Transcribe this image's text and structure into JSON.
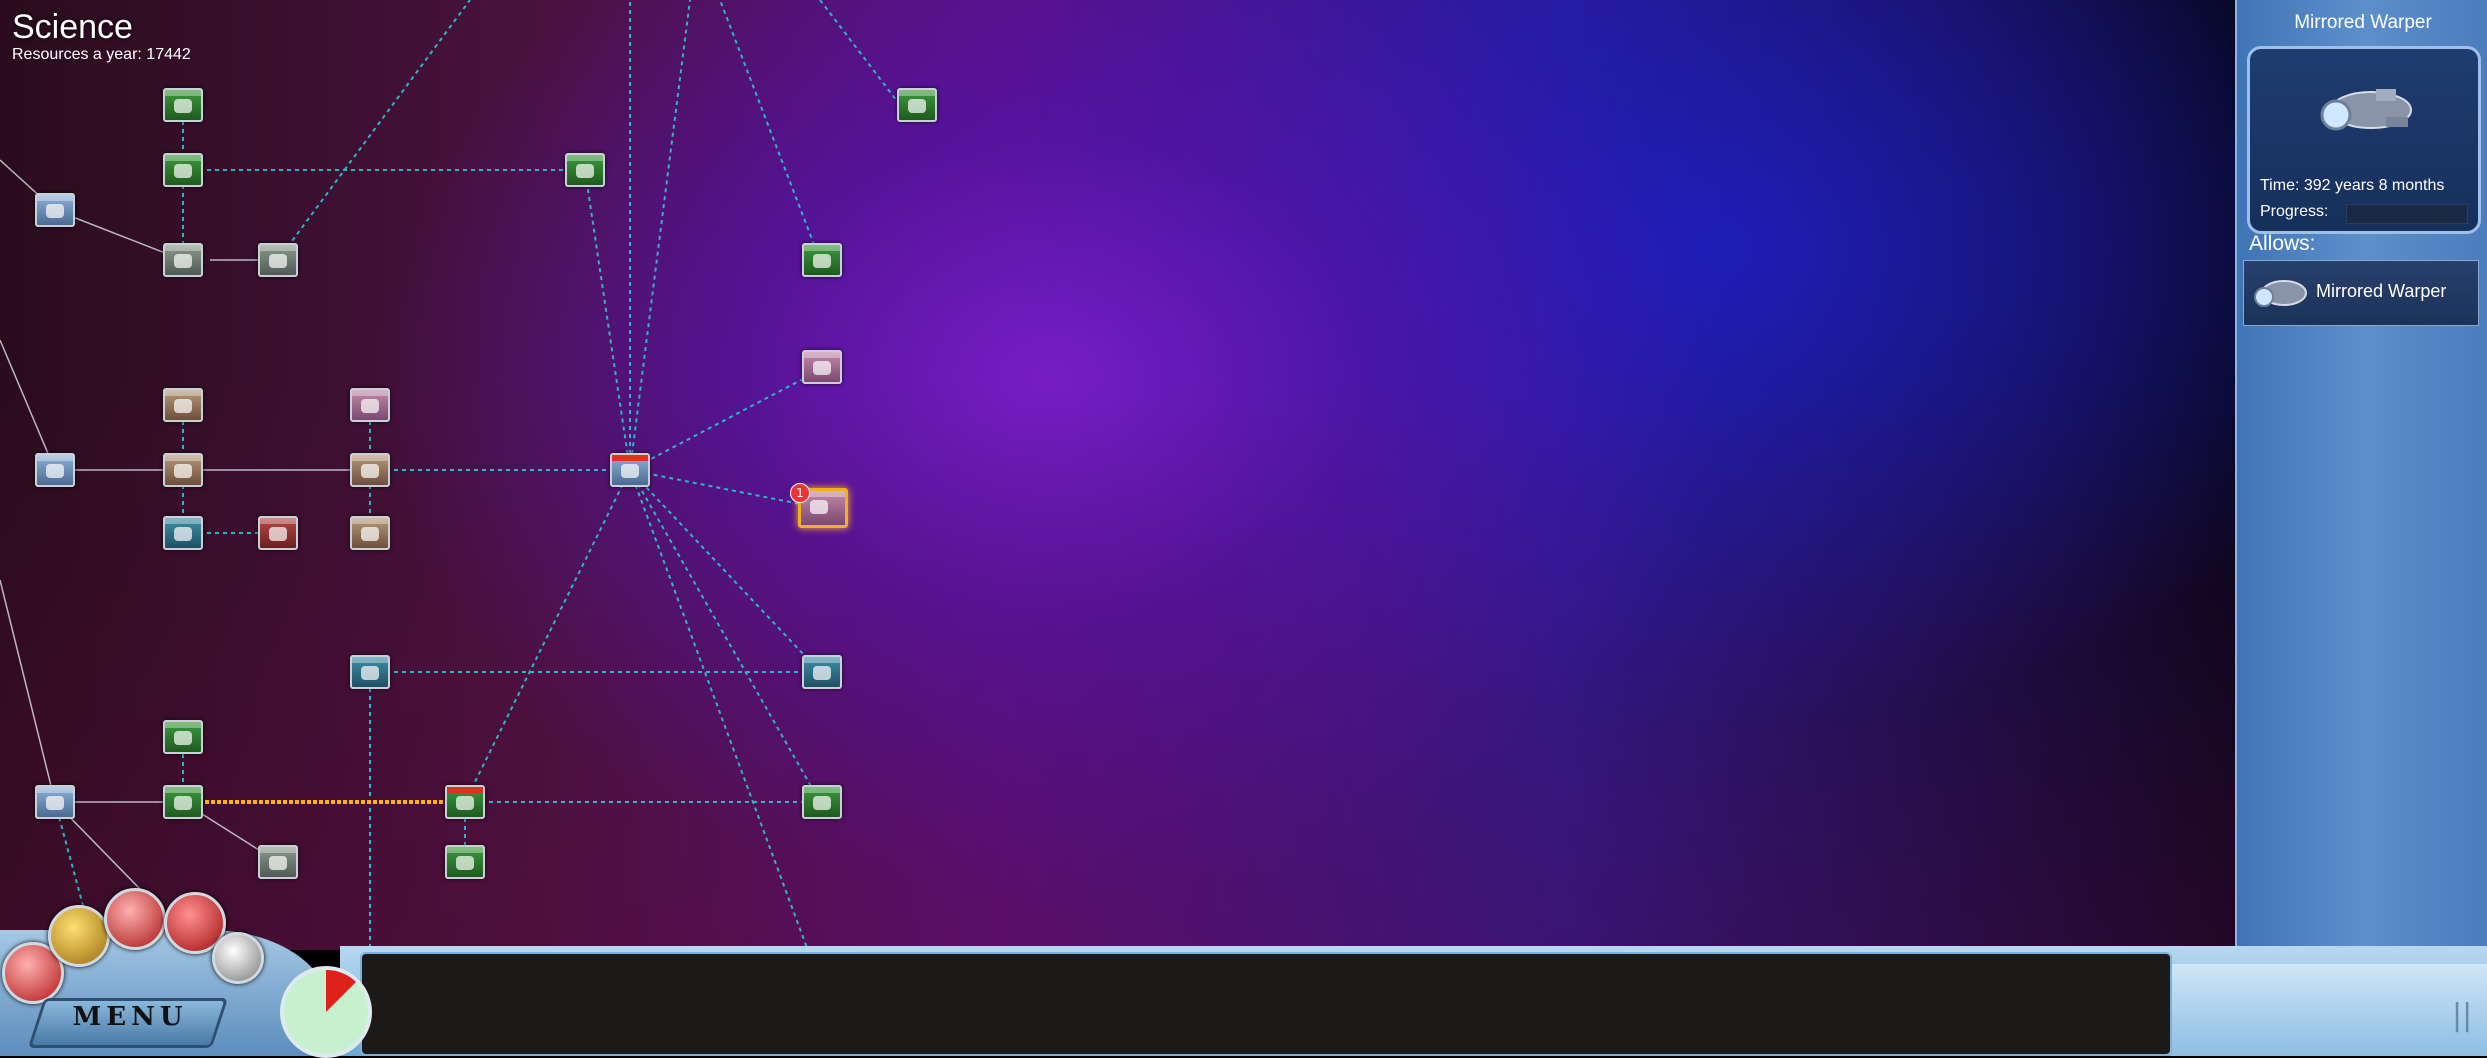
{
  "screen": {
    "title": "Science",
    "resources_label": "Resources a year:",
    "resources_value": "17442"
  },
  "tree": {
    "selected_badge": "1"
  },
  "panel": {
    "selected_name": "Mirrored Warper",
    "time_label": "Time:",
    "time_value": "392 years 8 months",
    "progress_label": "Progress:",
    "progress_fraction": 0,
    "allows_label": "Allows:",
    "allows": [
      {
        "name": "Mirrored Warper"
      }
    ]
  },
  "bottom": {
    "menu_label": "MENU",
    "message": "",
    "pause_label": "||"
  },
  "colors": {
    "link_line": "#2fb4c4",
    "active_link": "#ffb400",
    "panel_blue": "#4b7cbc"
  }
}
